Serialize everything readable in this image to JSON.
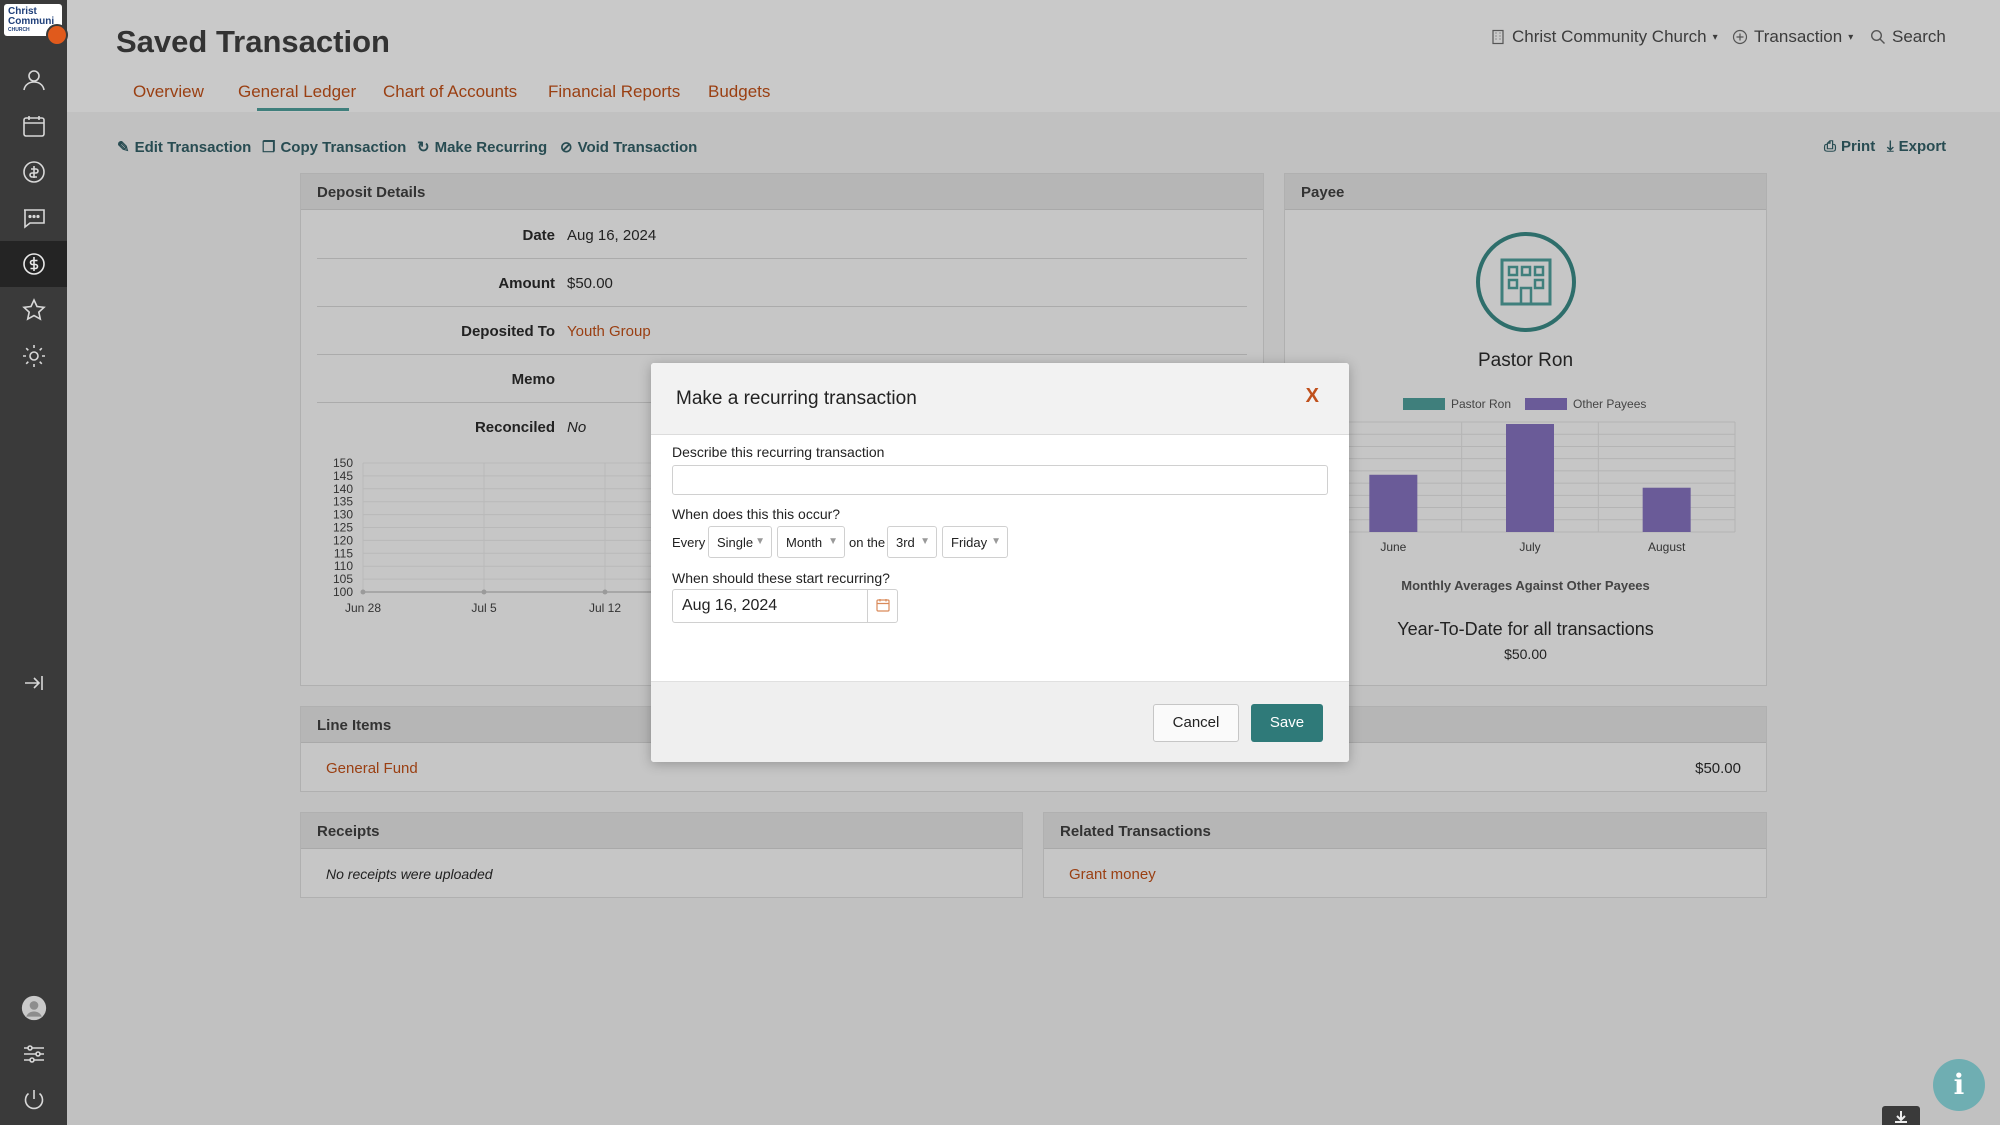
{
  "app": {
    "logo_text_line1": "Christ",
    "logo_text_line2": "Communi",
    "logo_text_line3": "CHURCH"
  },
  "header": {
    "title": "Saved Transaction",
    "tabs": [
      "Overview",
      "General Ledger",
      "Chart of Accounts",
      "Financial Reports",
      "Budgets"
    ],
    "active_tab": "General Ledger",
    "org_selector": "Christ Community Church",
    "new_menu": "Transaction",
    "search_label": "Search"
  },
  "toolbar": {
    "edit": "Edit Transaction",
    "copy": "Copy Transaction",
    "recurring": "Make Recurring",
    "void": "Void Transaction",
    "print": "Print",
    "export": "Export"
  },
  "deposit": {
    "heading": "Deposit Details",
    "rows": [
      {
        "label": "Date",
        "value": "Aug 16, 2024"
      },
      {
        "label": "Amount",
        "value": "$50.00"
      },
      {
        "label": "Deposited To",
        "value": "Youth Group"
      },
      {
        "label": "Memo",
        "value": ""
      },
      {
        "label": "Reconciled",
        "value": "No"
      }
    ]
  },
  "chart_data": [
    {
      "type": "line",
      "title": "",
      "x": [
        "Jun 28",
        "Jul 5",
        "Jul 12"
      ],
      "series": [],
      "yticks": [
        100,
        105,
        110,
        115,
        120,
        125,
        130,
        135,
        140,
        145,
        150
      ],
      "ylim": [
        100,
        150
      ],
      "grid": true
    },
    {
      "type": "bar",
      "title": "Monthly Averages Against Other Payees",
      "categories": [
        "June",
        "July",
        "August"
      ],
      "series": [
        {
          "name": "Pastor Ron",
          "values": [
            0,
            0,
            0
          ]
        },
        {
          "name": "Other Payees",
          "values": [
            53,
            100,
            41
          ]
        }
      ],
      "legend": "top",
      "grid": true
    }
  ],
  "payee": {
    "heading": "Payee",
    "name": "Pastor Ron",
    "legend_a": "Pastor Ron",
    "legend_b": "Other Payees",
    "chart_caption": "Monthly Averages Against Other Payees",
    "ytd_label": "Year-To-Date for all transactions",
    "ytd_value": "$50.00",
    "color_a": "#3f7f7c",
    "color_b": "#6a5b98"
  },
  "line_items": {
    "heading": "Line Items",
    "item": "General Fund",
    "amount": "$50.00"
  },
  "receipts": {
    "heading": "Receipts",
    "empty": "No receipts were uploaded"
  },
  "related": {
    "heading": "Related Transactions",
    "item": "Grant money"
  },
  "modal": {
    "title": "Make a recurring transaction",
    "close": "X",
    "describe_label": "Describe this recurring transaction",
    "describe_value": "",
    "occur_label": "When does this this occur?",
    "every": "Every",
    "frequency": "Single",
    "period": "Month",
    "on_the": "on the",
    "ordinal": "3rd",
    "weekday": "Friday",
    "start_label": "When should these start recurring?",
    "start_date": "Aug 16, 2024",
    "cancel": "Cancel",
    "save": "Save"
  }
}
